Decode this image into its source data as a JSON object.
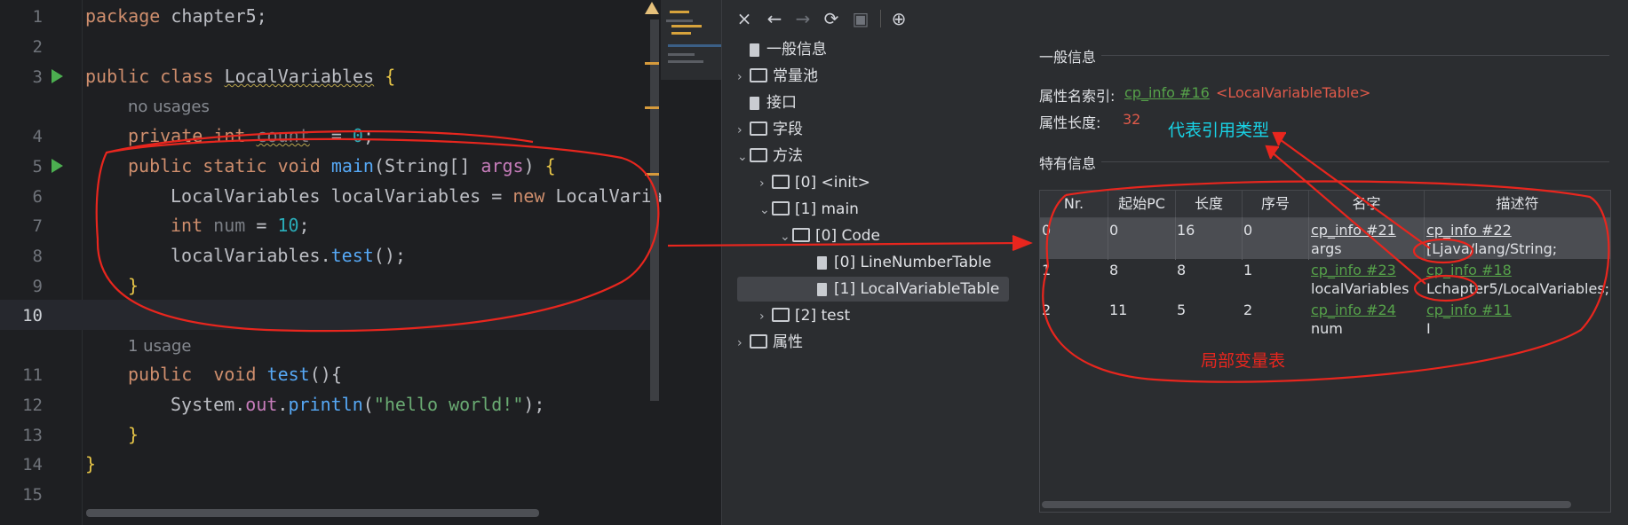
{
  "editor": {
    "line_numbers": [
      "1",
      "2",
      "3",
      "4",
      "5",
      "6",
      "7",
      "8",
      "9",
      "10",
      "11",
      "12",
      "13",
      "14",
      "15"
    ],
    "code": {
      "l1_kw": "package",
      "l1_rest": " chapter5;",
      "l3_kw1": "public",
      "l3_kw2": "class",
      "l3_name": "LocalVariables",
      "l3_brace": "{",
      "hint_no_usages": "no usages",
      "l4_kw": "private",
      "l4_type": "int",
      "l4_field": "count",
      "l4_eq": "  = ",
      "l4_num": "0",
      "l4_end": ";",
      "l5_kw1": "public",
      "l5_kw2": "static",
      "l5_kw3": "void",
      "l5_fn": "main",
      "l5_params_open": "(String[] ",
      "l5_param": "args",
      "l5_params_close": ") ",
      "l5_brace": "{",
      "l6_text": "LocalVariables localVariables = ",
      "l6_kw": "new",
      "l6_rest": " LocalVaria",
      "l7_type": "int",
      "l7_var": " num",
      "l7_eq": " = ",
      "l7_num": "10",
      "l7_end": ";",
      "l8_obj": "localVariables.",
      "l8_fn": "test",
      "l8_end": "();",
      "l9_brace": "}",
      "hint_1_usage": "1 usage",
      "l11_kw1": "public",
      "l11_kw2": "void",
      "l11_fn": "test",
      "l11_end": "(){",
      "l12_obj": "System.",
      "l12_fld": "out",
      "l12_dot": ".",
      "l12_fn": "println",
      "l12_open": "(",
      "l12_str": "\"hello world!\"",
      "l12_close": ");",
      "l13_brace": "}",
      "l14_brace": "}"
    }
  },
  "panel": {
    "toolbar": {
      "close_icon": "×",
      "back_icon": "←",
      "forward_icon": "→",
      "refresh_icon": "⟳",
      "save_icon": "▣",
      "globe_icon": "⊕"
    },
    "tree": {
      "general": "一般信息",
      "constant_pool": "常量池",
      "interfaces": "接口",
      "fields": "字段",
      "methods": "方法",
      "init": "[0] <init>",
      "main": "[1] main",
      "code": "[0] Code",
      "line_number_table": "[0] LineNumberTable",
      "local_variable_table": "[1] LocalVariableTable",
      "test": "[2] test",
      "attributes": "属性"
    },
    "general_section": "一般信息",
    "attr_name_index_label": "属性名索引:",
    "attr_name_index_link": "cp_info #16",
    "attr_name_index_value": "<LocalVariableTable>",
    "attr_length_label": "属性长度:",
    "attr_length_value": "32",
    "specific_section": "特有信息",
    "table": {
      "headers": [
        "Nr.",
        "起始PC",
        "长度",
        "序号",
        "名字",
        "描述符"
      ],
      "rows": [
        {
          "nr": "0",
          "start_pc": "0",
          "length": "16",
          "index": "0",
          "name_link": "cp_info #21",
          "name": "args",
          "desc_link": "cp_info #22",
          "desc": "[Ljava/lang/String;"
        },
        {
          "nr": "1",
          "start_pc": "8",
          "length": "8",
          "index": "1",
          "name_link": "cp_info #23",
          "name": "localVariables",
          "desc_link": "cp_info #18",
          "desc": "Lchapter5/LocalVariables;"
        },
        {
          "nr": "2",
          "start_pc": "11",
          "length": "5",
          "index": "2",
          "name_link": "cp_info #24",
          "name": "num",
          "desc_link": "cp_info #11",
          "desc": "I"
        }
      ]
    }
  },
  "annotations": {
    "ref_type": "代表引用类型",
    "local_var_table": "局部变量表"
  },
  "colors": {
    "annotation_red": "#e8261e",
    "annotation_cyan": "#19d3e6",
    "link_green": "#56a24a"
  }
}
